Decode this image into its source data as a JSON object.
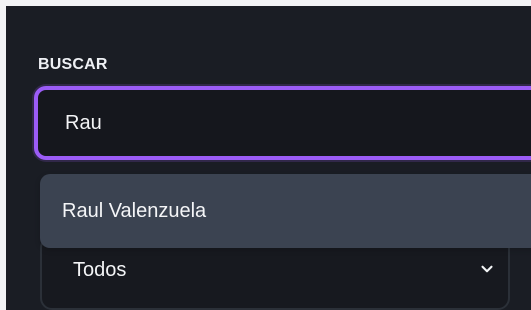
{
  "search": {
    "label": "BUSCAR",
    "value": "Rau"
  },
  "autocomplete": {
    "items": [
      "Raul Valenzuela"
    ]
  },
  "filter": {
    "selected": "Todos"
  },
  "icons": {
    "select_chevron": "chevron-down-icon"
  },
  "colors": {
    "accent": "#9b5cf6",
    "panel_background": "#1a1d24",
    "input_background": "#15171d",
    "suggestion_background": "#3b4351",
    "text_primary": "#f3f4f6"
  }
}
